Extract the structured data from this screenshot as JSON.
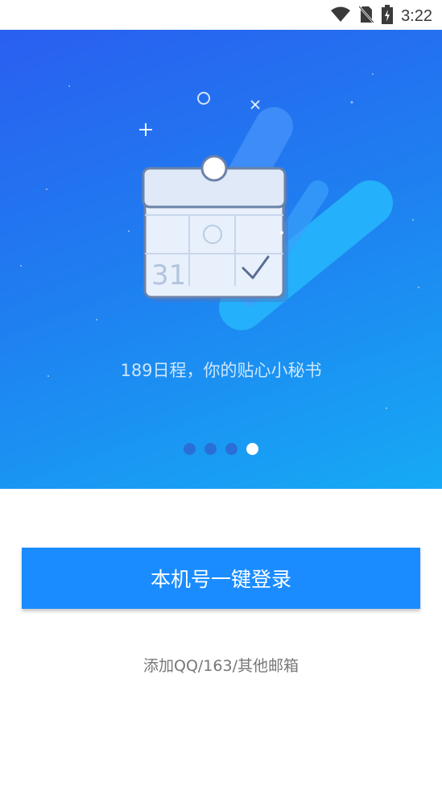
{
  "status_bar": {
    "time": "3:22",
    "icons": [
      "wifi-icon",
      "no-sim-icon",
      "battery-charging-icon"
    ]
  },
  "hero": {
    "calendar_number": "31",
    "tagline": "189日程，你的贴心小秘书",
    "page_indicator": {
      "total": 4,
      "active": 4
    }
  },
  "actions": {
    "login_label": "本机号一键登录",
    "add_mail_label": "添加QQ/163/其他邮箱"
  },
  "colors": {
    "primary_button": "#1a8cff",
    "hero_gradient_start": "#2a5ff0",
    "hero_gradient_end": "#16aaf5"
  }
}
